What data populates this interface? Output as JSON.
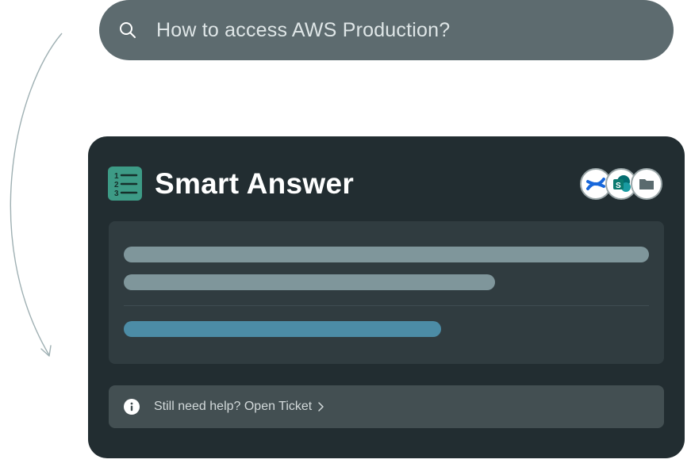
{
  "search": {
    "query": "How to access AWS Production?",
    "icon": "search-icon"
  },
  "card": {
    "title": "Smart Answer",
    "title_icon": "numbered-list-icon",
    "sources": [
      {
        "name": "confluence-icon",
        "color": "#1868db"
      },
      {
        "name": "sharepoint-icon",
        "color": "#0b7a6f"
      },
      {
        "name": "folder-icon",
        "color": "#5a6a6e"
      }
    ],
    "help": {
      "text": "Still need help? Open Ticket",
      "icon": "info-icon",
      "chevron": "chevron-right-icon"
    }
  },
  "colors": {
    "search_bg": "#5d6b6f",
    "card_bg": "#222d31",
    "panel_bg": "#303c40",
    "placeholder_bar": "#7f969b",
    "link_bar": "#4c8ca6",
    "accent_green": "#3d9b86"
  }
}
